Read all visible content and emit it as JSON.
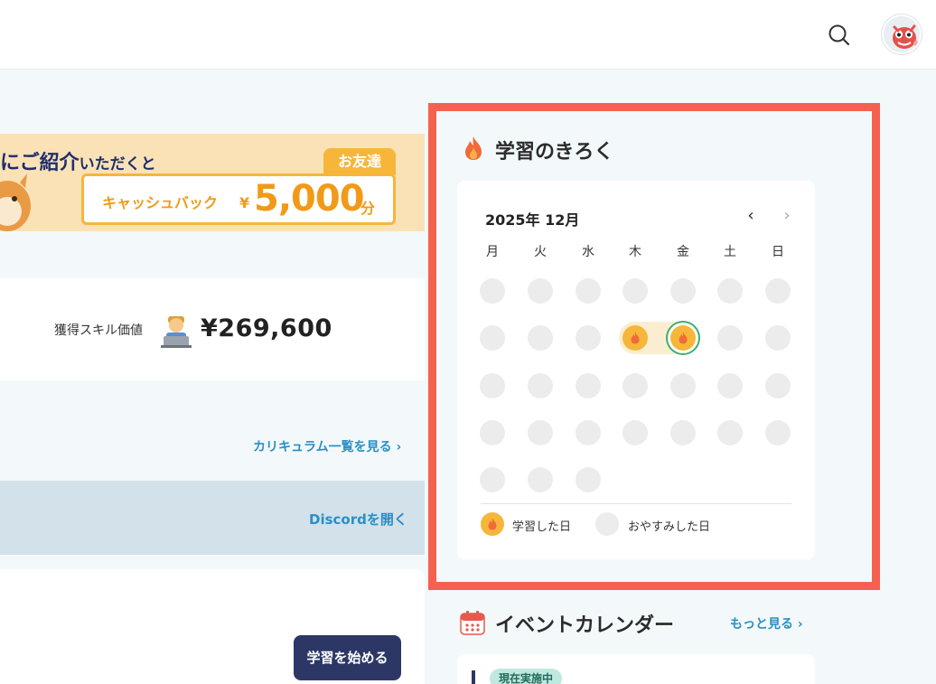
{
  "header": {
    "search_icon": "search-icon",
    "avatar_icon": "avatar-mascot"
  },
  "banner": {
    "line_big1": "ご紹介",
    "line_prefix": "に",
    "line_small": "いただくと",
    "tag": "お友達",
    "cashback_label": "キャッシュバック",
    "cashback_yen": "¥",
    "cashback_amount": "5,000",
    "cashback_unit": "分"
  },
  "skill": {
    "label": "獲得スキル価値",
    "value": "¥269,600"
  },
  "curriculum": {
    "link": "カリキュラム一覧を見る ›"
  },
  "discord": {
    "link": "Discordを開く"
  },
  "course": {
    "start_button": "学習を始める"
  },
  "record": {
    "title": "学習のきろく",
    "month": "2025年 12月",
    "prev": "‹",
    "next": "›",
    "weekdays": [
      "月",
      "火",
      "水",
      "木",
      "金",
      "土",
      "日"
    ],
    "studied_days": [
      11,
      12
    ],
    "today": 12,
    "days_in_month": 31,
    "legend": {
      "studied": "学習した日",
      "rest": "おやすみした日"
    },
    "colors": {
      "studied": "#f6b63a",
      "rest": "#ececec",
      "today_ring": "#3cae72",
      "frame": "#f4624f"
    }
  },
  "events": {
    "title": "イベントカレンダー",
    "more": "もっと見る ›",
    "badge": "現在実施中"
  }
}
